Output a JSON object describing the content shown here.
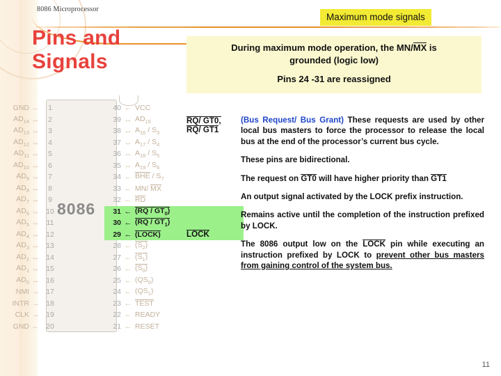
{
  "doc": {
    "id": "8086 Microprocessor",
    "title": "Pins and Signals",
    "page_number": "11"
  },
  "banner": {
    "label": "Maximum mode signals"
  },
  "infobox": {
    "line1_a": "During maximum mode operation, the MN/",
    "line1_overline": "MX",
    "line1_b": " is",
    "line1_c": "grounded (logic low)",
    "line2": "Pins 24 -31 are reassigned"
  },
  "chip": {
    "label": "8086",
    "left_pins": [
      {
        "sig": "GND",
        "arrow": "←",
        "num": "1"
      },
      {
        "sig": "AD14",
        "arrow": "↔",
        "num": "2"
      },
      {
        "sig": "AD13",
        "arrow": "↔",
        "num": "3"
      },
      {
        "sig": "AD12",
        "arrow": "↔",
        "num": "4"
      },
      {
        "sig": "AD11",
        "arrow": "↔",
        "num": "5"
      },
      {
        "sig": "AD10",
        "arrow": "↔",
        "num": "6"
      },
      {
        "sig": "AD9",
        "arrow": "↔",
        "num": "7"
      },
      {
        "sig": "AD8",
        "arrow": "↔",
        "num": "8"
      },
      {
        "sig": "AD7",
        "arrow": "↔",
        "num": "9"
      },
      {
        "sig": "AD6",
        "arrow": "↔",
        "num": "10"
      },
      {
        "sig": "AD5",
        "arrow": "↔",
        "num": "11"
      },
      {
        "sig": "AD4",
        "arrow": "↔",
        "num": "12"
      },
      {
        "sig": "AD3",
        "arrow": "↔",
        "num": "13"
      },
      {
        "sig": "AD2",
        "arrow": "↔",
        "num": "14"
      },
      {
        "sig": "AD1",
        "arrow": "↔",
        "num": "15"
      },
      {
        "sig": "AD0",
        "arrow": "↔",
        "num": "16"
      },
      {
        "sig": "NMI",
        "arrow": "→",
        "num": "17"
      },
      {
        "sig": "INTR",
        "arrow": "→",
        "num": "18"
      },
      {
        "sig": "CLK",
        "arrow": "→",
        "num": "19"
      },
      {
        "sig": "GND",
        "arrow": "←",
        "num": "20"
      }
    ],
    "right_pins": [
      {
        "num": "40",
        "arrow": "←",
        "sig": "VCC",
        "highlight": false
      },
      {
        "num": "39",
        "arrow": "↔",
        "sig": "AD15",
        "highlight": false
      },
      {
        "num": "38",
        "arrow": "↔",
        "sig": "A16 / S3",
        "highlight": false
      },
      {
        "num": "37",
        "arrow": "↔",
        "sig": "A17 / S4",
        "highlight": false
      },
      {
        "num": "36",
        "arrow": "↔",
        "sig": "A18 / S5",
        "highlight": false
      },
      {
        "num": "35",
        "arrow": "↔",
        "sig": "A19 / S6",
        "highlight": false
      },
      {
        "num": "34",
        "arrow": "←",
        "sig": "BHE / S7",
        "highlight": false
      },
      {
        "num": "33",
        "arrow": "←",
        "sig": "MN/ MX",
        "highlight": false
      },
      {
        "num": "32",
        "arrow": "←",
        "sig": "RD",
        "highlight": false
      },
      {
        "num": "31",
        "arrow": "←",
        "sig": "(RQ / GT0)",
        "highlight": true
      },
      {
        "num": "30",
        "arrow": "←",
        "sig": "(RQ / GT1)",
        "highlight": true
      },
      {
        "num": "29",
        "arrow": "←",
        "sig": "(LOCK)",
        "highlight": true
      },
      {
        "num": "28",
        "arrow": "←",
        "sig": "(S2)",
        "highlight": false
      },
      {
        "num": "27",
        "arrow": "←",
        "sig": "(S1)",
        "highlight": false
      },
      {
        "num": "26",
        "arrow": "←",
        "sig": "(S0)",
        "highlight": false
      },
      {
        "num": "25",
        "arrow": "←",
        "sig": "(QS0)",
        "highlight": false
      },
      {
        "num": "24",
        "arrow": "←",
        "sig": "(QS1)",
        "highlight": false
      },
      {
        "num": "23",
        "arrow": "←",
        "sig": "TEST",
        "highlight": false
      },
      {
        "num": "22",
        "arrow": "←",
        "sig": "READY",
        "highlight": false
      },
      {
        "num": "21",
        "arrow": "←",
        "sig": "RESET",
        "highlight": false
      }
    ]
  },
  "side_labels": {
    "rq_gt_line1": "RQ/ GT0,",
    "rq_gt_line2": "RQ/ GT1",
    "lock": "LOCK"
  },
  "description": {
    "p1_blue": "(Bus Request/ Bus Grant)",
    "p1_rest": " These requests are used by other local bus masters to force the processor to release the local bus at the end of the processor’s current bus cycle.",
    "p2": "These pins are bidirectional.",
    "p3_a": "The request on ",
    "p3_b": "GT0",
    "p3_c": " will have higher priority than ",
    "p3_d": "GT1",
    "p4": "An output signal activated by the LOCK prefix instruction.",
    "p5": "Remains active until the completion of the instruction prefixed by LOCK.",
    "p6_a": "The 8086 output low on the ",
    "p6_b": "LOCK",
    "p6_c": " pin while executing an instruction prefixed by LOCK to ",
    "p6_underlined": "prevent other bus masters from gaining control of the system bus."
  },
  "colors": {
    "title": "#e8413c",
    "banner_bg": "#f2ea33",
    "infobox_bg": "#fbf8cf",
    "highlight": "#9bf08a",
    "accent_rule": "#e8922a",
    "blue_text": "#1f46c8"
  }
}
